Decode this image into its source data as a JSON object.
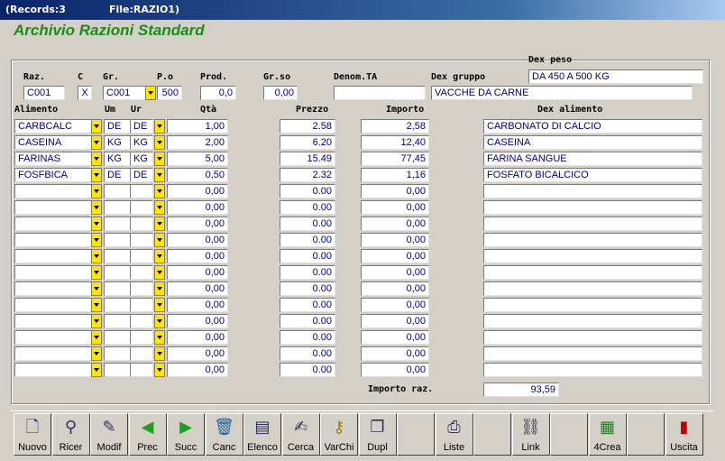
{
  "window": {
    "records": "(Records:3",
    "file": "File:RAZIO1)"
  },
  "app_title": "Archivio Razioni Standard",
  "labels": {
    "raz": "Raz.",
    "c": "C",
    "gr": "Gr.",
    "po": "P.o",
    "prod": "Prod.",
    "grso": "Gr.so",
    "denom": "Denom.TA",
    "dex_gruppo": "Dex gruppo",
    "dex_peso": "Dex peso",
    "alimento": "Alimento",
    "um": "Um",
    "ur": "Ur",
    "qta": "Qtà",
    "prezzo": "Prezzo",
    "importo": "Importo",
    "dex_alimento": "Dex alimento",
    "importo_raz": "Importo raz."
  },
  "header": {
    "raz": "C001",
    "c": "X",
    "gr": "C001",
    "po": "500",
    "prod": "0,0",
    "grso": "0,00",
    "denom": "",
    "dex_gruppo": "VACCHE DA CARNE",
    "dex_peso": "DA 450 A 500 KG"
  },
  "rows": [
    {
      "alimento": "CARBCALC",
      "um": "DE",
      "ur": "DE",
      "qta": "1,00",
      "prezzo": "2.58",
      "importo": "2,58",
      "dex": "CARBONATO DI CALCIO"
    },
    {
      "alimento": "CASEINA",
      "um": "KG",
      "ur": "KG",
      "qta": "2,00",
      "prezzo": "6.20",
      "importo": "12,40",
      "dex": "CASEINA"
    },
    {
      "alimento": "FARINAS",
      "um": "KG",
      "ur": "KG",
      "qta": "5,00",
      "prezzo": "15.49",
      "importo": "77,45",
      "dex": "FARINA SANGUE"
    },
    {
      "alimento": "FOSFBICA",
      "um": "DE",
      "ur": "DE",
      "qta": "0,50",
      "prezzo": "2.32",
      "importo": "1,16",
      "dex": "FOSFATO BICALCICO"
    },
    {
      "alimento": "",
      "um": "",
      "ur": "",
      "qta": "0,00",
      "prezzo": "0.00",
      "importo": "0,00",
      "dex": ""
    },
    {
      "alimento": "",
      "um": "",
      "ur": "",
      "qta": "0,00",
      "prezzo": "0.00",
      "importo": "0,00",
      "dex": ""
    },
    {
      "alimento": "",
      "um": "",
      "ur": "",
      "qta": "0,00",
      "prezzo": "0.00",
      "importo": "0,00",
      "dex": ""
    },
    {
      "alimento": "",
      "um": "",
      "ur": "",
      "qta": "0,00",
      "prezzo": "0.00",
      "importo": "0,00",
      "dex": ""
    },
    {
      "alimento": "",
      "um": "",
      "ur": "",
      "qta": "0,00",
      "prezzo": "0.00",
      "importo": "0,00",
      "dex": ""
    },
    {
      "alimento": "",
      "um": "",
      "ur": "",
      "qta": "0,00",
      "prezzo": "0.00",
      "importo": "0,00",
      "dex": ""
    },
    {
      "alimento": "",
      "um": "",
      "ur": "",
      "qta": "0,00",
      "prezzo": "0.00",
      "importo": "0,00",
      "dex": ""
    },
    {
      "alimento": "",
      "um": "",
      "ur": "",
      "qta": "0,00",
      "prezzo": "0.00",
      "importo": "0,00",
      "dex": ""
    },
    {
      "alimento": "",
      "um": "",
      "ur": "",
      "qta": "0,00",
      "prezzo": "0.00",
      "importo": "0,00",
      "dex": ""
    },
    {
      "alimento": "",
      "um": "",
      "ur": "",
      "qta": "0,00",
      "prezzo": "0.00",
      "importo": "0,00",
      "dex": ""
    },
    {
      "alimento": "",
      "um": "",
      "ur": "",
      "qta": "0,00",
      "prezzo": "0.00",
      "importo": "0,00",
      "dex": ""
    },
    {
      "alimento": "",
      "um": "",
      "ur": "",
      "qta": "0,00",
      "prezzo": "0.00",
      "importo": "0,00",
      "dex": ""
    }
  ],
  "importo_raz": "93,59",
  "toolbar": [
    {
      "label": "Nuovo",
      "icon": "new-document-icon"
    },
    {
      "label": "Ricer",
      "icon": "search-icon"
    },
    {
      "label": "Modif",
      "icon": "edit-icon"
    },
    {
      "label": "Prec",
      "icon": "arrow-left-icon"
    },
    {
      "label": "Succ",
      "icon": "arrow-right-icon"
    },
    {
      "label": "Canc",
      "icon": "trash-icon"
    },
    {
      "label": "Elenco",
      "icon": "list-icon"
    },
    {
      "label": "Cerca",
      "icon": "find-icon"
    },
    {
      "label": "VarChi",
      "icon": "keys-icon"
    },
    {
      "label": "Dupl",
      "icon": "duplicate-icon"
    },
    {
      "label": "",
      "icon": ""
    },
    {
      "label": "Liste",
      "icon": "printer-icon"
    },
    {
      "label": "",
      "icon": ""
    },
    {
      "label": "Link",
      "icon": "link-icon"
    },
    {
      "label": "",
      "icon": ""
    },
    {
      "label": "4Crea",
      "icon": "create-icon"
    },
    {
      "label": "",
      "icon": ""
    },
    {
      "label": "Uscita",
      "icon": "exit-door-icon"
    }
  ]
}
